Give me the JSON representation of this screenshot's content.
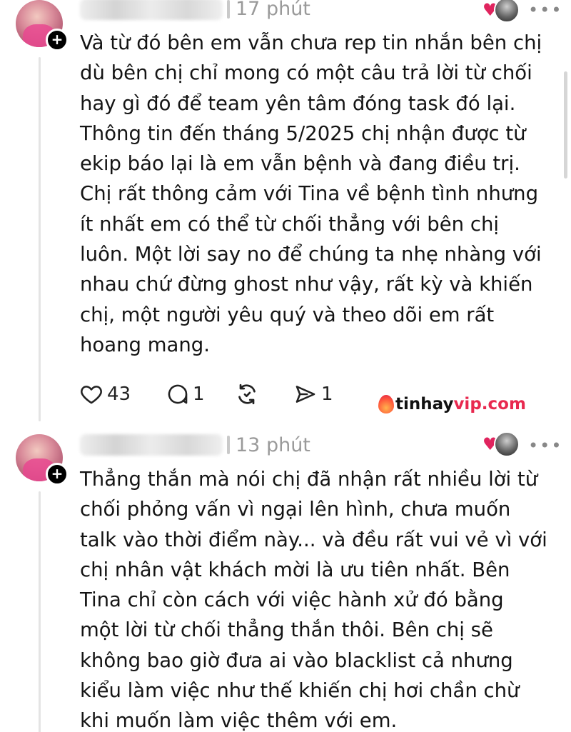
{
  "posts": [
    {
      "username": "ngangiangihihi",
      "time": "17 phút",
      "body_lines": [
        "Và từ đó bên em vẫn chưa rep tin nhắn bên chị",
        "dù bên chị chỉ mong có một câu trả lời từ chối",
        "hay gì đó để team yên tâm đóng task đó lại.",
        "Thông tin đến tháng 5/2025 chị nhận được từ",
        "ekip báo lại là em vẫn bệnh và đang điều trị.",
        "Chị rất thông cảm với Tina về bệnh tình nhưng",
        "ít nhất em có thể từ chối thẳng với bên chị",
        "luôn. Một lời say no để chúng ta nhẹ nhàng với",
        "nhau chứ đừng ghost như vậy, rất kỳ và khiến",
        "chị, một người yêu quý và theo dõi em rất",
        "hoang mang."
      ],
      "actions": {
        "like_count": "43",
        "reply_count": "1",
        "share_count": "1"
      }
    },
    {
      "username": "ngangiangihihi",
      "time": "13 phút",
      "body_lines": [
        "Thẳng thắn mà nói chị đã nhận rất nhiều lời từ",
        "chối phỏng vấn vì ngại lên hình, chưa muốn",
        "talk vào thời điểm này... và đều rất vui vẻ vì với",
        "chị nhân vật khách mời là ưu tiên nhất. Bên",
        "Tina chỉ còn cách với việc hành xử đó bằng",
        "một lời từ chối thẳng thắn thôi. Bên chị sẽ",
        "không bao giờ đưa ai vào blacklist cả nhưng",
        "kiểu làm việc như thế khiến chị hơi chần chừ",
        "khi muốn làm việc thêm với em."
      ]
    }
  ],
  "follow_symbol": "+",
  "more_symbol": "•••",
  "watermark": {
    "main": "tinhay",
    "vip": "vip",
    "tld": ".com"
  },
  "colors": {
    "text": "#141414",
    "muted": "#9a9a9a",
    "heart": "#e0245e",
    "watermark_accent": "#e8294f"
  },
  "icons": [
    "heart-icon",
    "comment-icon",
    "repost-icon",
    "share-icon",
    "more-icon",
    "follow-plus-icon"
  ]
}
